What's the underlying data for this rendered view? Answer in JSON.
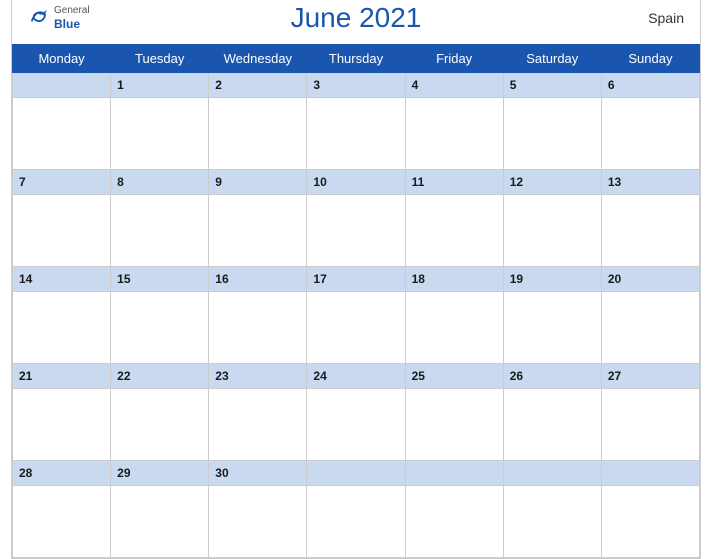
{
  "header": {
    "title": "June 2021",
    "country": "Spain",
    "logo": {
      "general": "General",
      "blue": "Blue"
    }
  },
  "weekdays": [
    "Monday",
    "Tuesday",
    "Wednesday",
    "Thursday",
    "Friday",
    "Saturday",
    "Sunday"
  ],
  "weeks": [
    [
      null,
      1,
      2,
      3,
      4,
      5,
      6
    ],
    [
      7,
      8,
      9,
      10,
      11,
      12,
      13
    ],
    [
      14,
      15,
      16,
      17,
      18,
      19,
      20
    ],
    [
      21,
      22,
      23,
      24,
      25,
      26,
      27
    ],
    [
      28,
      29,
      30,
      null,
      null,
      null,
      null
    ]
  ],
  "colors": {
    "header_bg": "#1a56b0",
    "row_header_bg": "#c8d9f0",
    "accent": "#1a56b0"
  }
}
